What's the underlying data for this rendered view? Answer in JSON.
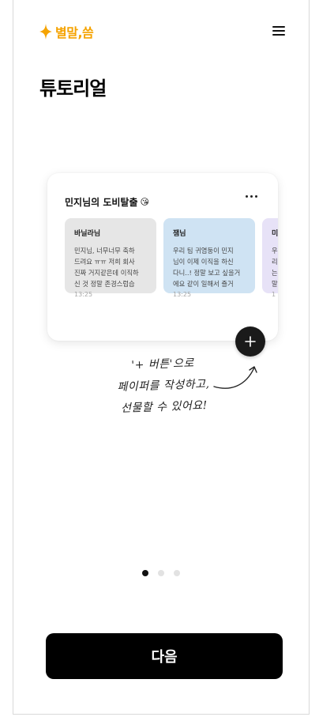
{
  "app": {
    "name": "별말,씀",
    "brand_color": "#f5a300"
  },
  "header": {
    "menu_icon": "hamburger-menu-icon"
  },
  "page_title": "튜토리얼",
  "board": {
    "title": "민지님의 도비탈출",
    "emoji": "😘",
    "more_icon": "more-horizontal-icon",
    "notes": [
      {
        "sender": "바닐라님",
        "body": "민지님, 너무너무 축하\n드려요 ㅠㅠ 저희 회사\n진짜 거지같은데 이직하\n신 것 정말 존경스럽습",
        "time": "13:25",
        "color": "#e6e6e6"
      },
      {
        "sender": "잼님",
        "body": "우리 팀 귀염둥이 민지\n님이 이제 이직을 하신\n다니..! 정말 보고 싶을거\n에요 같이 일해서 즐거",
        "time": "13:25",
        "color": "#cfe3f3"
      },
      {
        "sender": "미",
        "body": "우\n리\n는\n말",
        "time": "1",
        "color": "#e7e2f7"
      }
    ]
  },
  "fab": {
    "icon": "plus-icon"
  },
  "hint": {
    "lines": [
      "'+ 버튼'으로",
      "페이퍼를 작성하고,",
      "선물할 수 있어요!"
    ]
  },
  "pagination": {
    "current": 1,
    "total": 3
  },
  "next_button": {
    "label": "다음"
  }
}
